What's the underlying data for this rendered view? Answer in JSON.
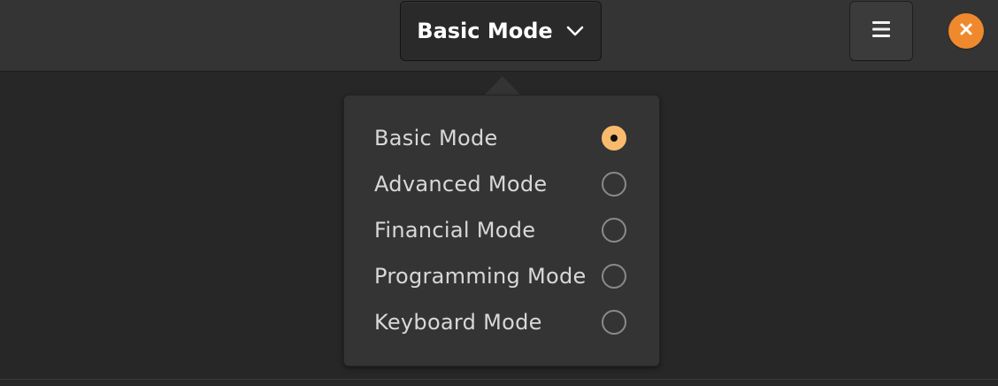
{
  "header": {
    "mode_button_label": "Basic Mode",
    "menu_icon": "hamburger-menu-icon",
    "close_icon": "close-icon"
  },
  "colors": {
    "accent": "#f9ba6e",
    "close": "#f0892d"
  },
  "mode_menu": {
    "options": [
      {
        "label": "Basic Mode",
        "selected": true
      },
      {
        "label": "Advanced Mode",
        "selected": false
      },
      {
        "label": "Financial Mode",
        "selected": false
      },
      {
        "label": "Programming Mode",
        "selected": false
      },
      {
        "label": "Keyboard Mode",
        "selected": false
      }
    ]
  }
}
